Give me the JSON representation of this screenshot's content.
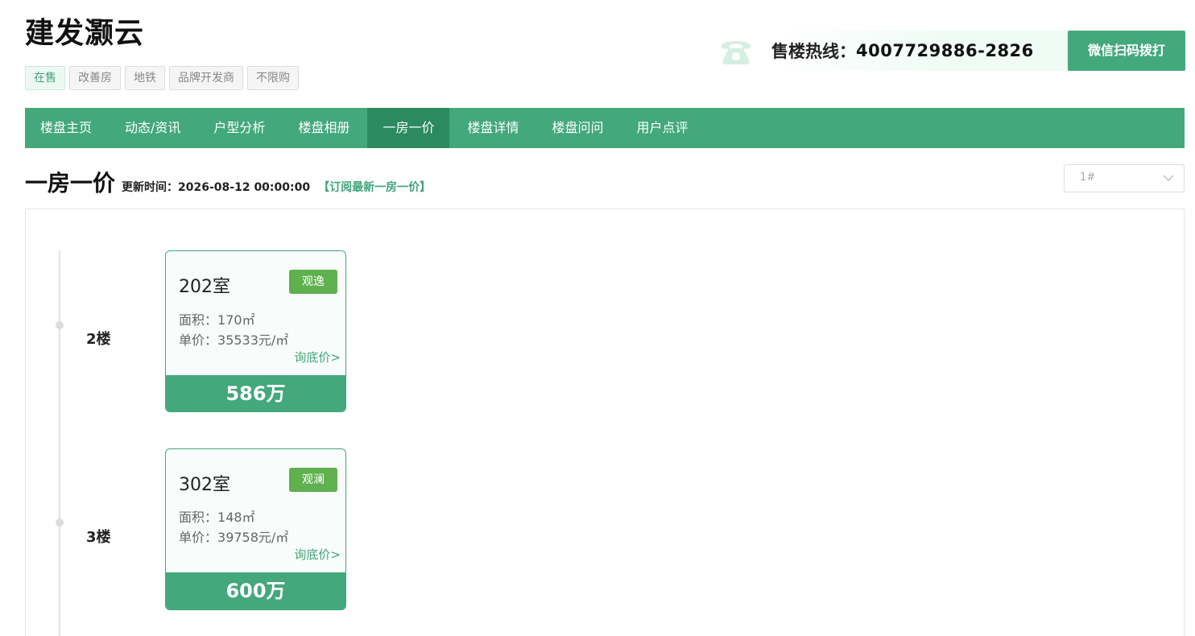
{
  "project": {
    "name": "建发灏云"
  },
  "tags": [
    "在售",
    "改善房",
    "地铁",
    "品牌开发商",
    "不限购"
  ],
  "hotline": {
    "label": "售楼热线：",
    "number": "4007729886-2826",
    "wechat_button": "微信扫码拨打"
  },
  "nav": {
    "items": [
      "楼盘主页",
      "动态/资讯",
      "户型分析",
      "楼盘相册",
      "一房一价",
      "楼盘详情",
      "楼盘问问",
      "用户点评"
    ],
    "active": "一房一价"
  },
  "section": {
    "title": "一房一价",
    "update_label": "更新时间：",
    "update_time": "2026-08-12 00:00:00",
    "subscribe": "【订阅最新一房一价】"
  },
  "building_select": {
    "value": "1#"
  },
  "floors": [
    {
      "floor_label": "2楼",
      "room": "202室",
      "badge": "观逸",
      "area_label": "面积：",
      "area": "170㎡",
      "price_label": "单价：",
      "unit_price": "35533元/㎡",
      "inquire": "询底价>",
      "total": "586万"
    },
    {
      "floor_label": "3楼",
      "room": "302室",
      "badge": "观澜",
      "area_label": "面积：",
      "area": "148㎡",
      "price_label": "单价：",
      "unit_price": "39758元/㎡",
      "inquire": "询底价>",
      "total": "600万"
    }
  ],
  "colors": {
    "brand": "#43a87c",
    "nav_active": "#2b8a60",
    "badge": "#5fb04f"
  },
  "icons": {
    "hotline": "phone-icon",
    "select": "chevron-down-icon"
  }
}
